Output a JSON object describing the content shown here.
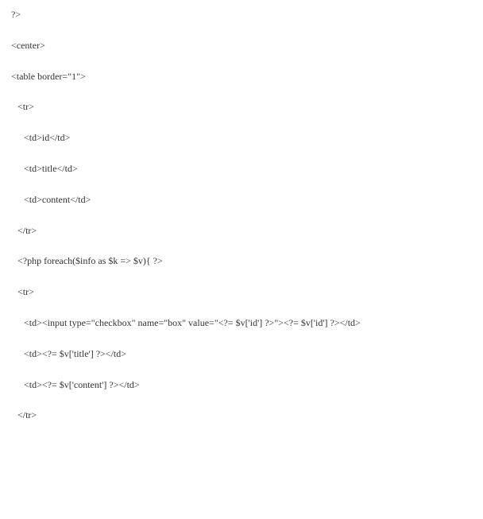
{
  "code": {
    "l1": "?>",
    "l2": "<center>",
    "l3": "<table border=\"1\">",
    "l4": "<tr>",
    "l5": "<td>id</td>",
    "l6": "<td>title</td>",
    "l7": "<td>content</td>",
    "l8": "</tr>",
    "l9": "<?php foreach($info as $k => $v){ ?>",
    "l10": "<tr>",
    "l11": "<td><input type=\"checkbox\" name=\"box\" value=\"<?= $v['id'] ?>\"><?= $v['id'] ?></td>",
    "l12": "<td><?= $v['title'] ?></td>",
    "l13": "<td><?= $v['content'] ?></td>",
    "l14": "</tr>"
  }
}
